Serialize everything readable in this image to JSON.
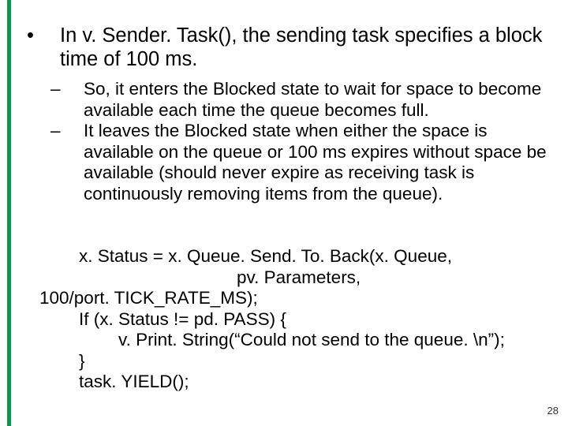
{
  "bullet1": "In v. Sender. Task(), the sending task specifies a block time of 100 ms.",
  "sub1": "So, it enters the Blocked state to wait for space to become available each time the queue becomes full.",
  "sub2": "It leaves the Blocked state when either the space is available on the queue or 100 ms expires without space be available (should never expire as receiving task is continuously removing items from the queue).",
  "code1": "        x. Status = x. Queue. Send. To. Back(x. Queue,",
  "code2": "                                        pv. Parameters,",
  "code3": "100/port. TICK_RATE_MS);",
  "code4": "        If (x. Status != pd. PASS) {",
  "code5": "                v. Print. String(“Could not send to the queue. \\n”);",
  "code6": "        }",
  "code7": "        task. YIELD();",
  "pageNumber": "28"
}
